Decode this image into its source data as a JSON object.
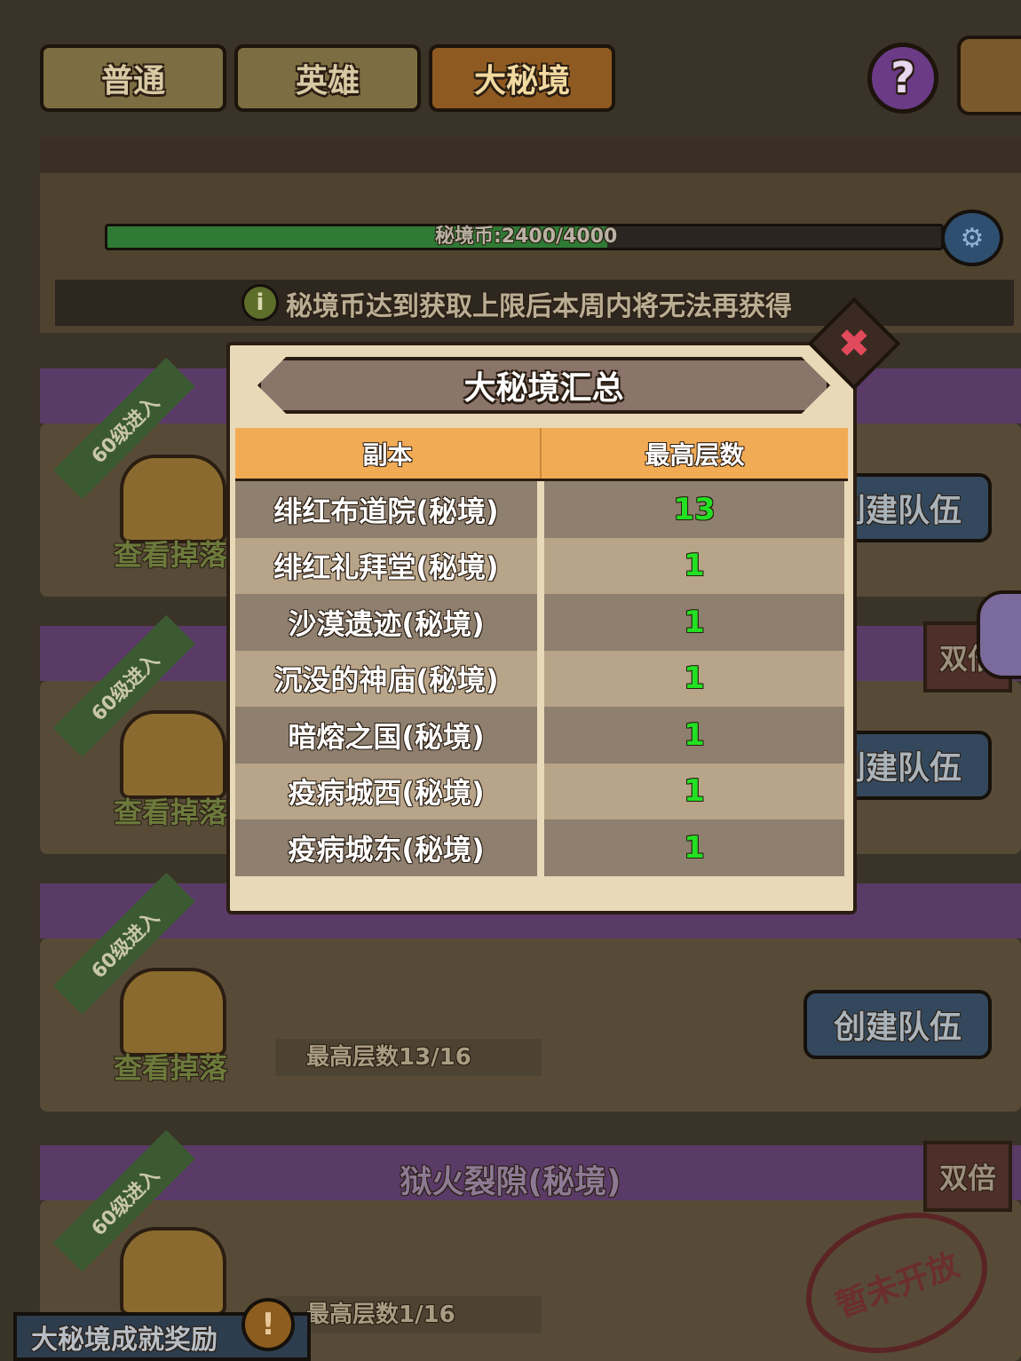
{
  "tabs": [
    {
      "label": "普通"
    },
    {
      "label": "英雄"
    },
    {
      "label": "大秘境"
    }
  ],
  "help": {
    "label": "?"
  },
  "coin": {
    "text": "秘境币:2400/4000",
    "current": 2400,
    "max": 4000
  },
  "info": {
    "icon": "i",
    "text": "秘境币达到获取上限后本周内将无法再获得"
  },
  "cards": [
    {
      "level": "60级进入",
      "drop": "查看掉落",
      "team": "创建队伍"
    },
    {
      "level": "60级进入",
      "drop": "查看掉落",
      "team": "创建队伍",
      "double": "双倍"
    },
    {
      "level": "60级进入",
      "drop": "查看掉落",
      "team": "创建队伍",
      "maxfloor": "最高层数13/16"
    },
    {
      "level": "60级进入",
      "title": "狱火裂隙(秘境)",
      "double": "双倍",
      "maxfloor": "最高层数1/16",
      "stamp": "暂未开放"
    }
  ],
  "achievement": {
    "label": "大秘境成就奖励",
    "icon": "!"
  },
  "modal": {
    "title": "大秘境汇总",
    "close": "✖",
    "headers": {
      "dungeon": "副本",
      "max_floor": "最高层数"
    },
    "rows": [
      {
        "name": "绯红布道院(秘境)",
        "floor": "13"
      },
      {
        "name": "绯红礼拜堂(秘境)",
        "floor": "1"
      },
      {
        "name": "沙漠遗迹(秘境)",
        "floor": "1"
      },
      {
        "name": "沉没的神庙(秘境)",
        "floor": "1"
      },
      {
        "name": "暗熔之国(秘境)",
        "floor": "1"
      },
      {
        "name": "疫病城西(秘境)",
        "floor": "1"
      },
      {
        "name": "疫病城东(秘境)",
        "floor": "1"
      }
    ]
  }
}
